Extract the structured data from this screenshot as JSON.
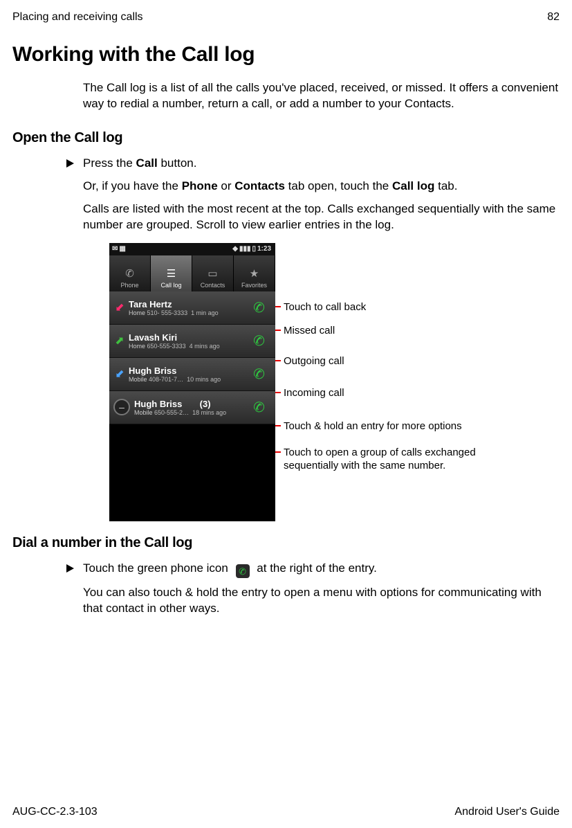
{
  "header": {
    "section": "Placing and receiving calls",
    "page": "82"
  },
  "title": "Working with the Call log",
  "intro": "The Call log is a list of all the calls you've placed, received, or missed. It offers a convenient way to redial a number, return a call, or add a number to your Contacts.",
  "open": {
    "heading": "Open the Call log",
    "step_prefix": "Press the ",
    "step_bold": "Call",
    "step_suffix": " button.",
    "or_prefix": "Or, if you have the ",
    "or_b1": "Phone",
    "or_mid1": " or ",
    "or_b2": "Contacts",
    "or_mid2": " tab open, touch the ",
    "or_b3": "Call log",
    "or_suffix": " tab.",
    "note": "Calls are listed with the most recent at the top. Calls exchanged sequentially with the same number are grouped. Scroll to view earlier entries in the log."
  },
  "phone": {
    "time": "1:23",
    "tabs": [
      "Phone",
      "Call log",
      "Contacts",
      "Favorites"
    ],
    "rows": [
      {
        "name": "Tara Hertz",
        "label": "Home",
        "number": "510- 555-3333",
        "ago": "1 min ago",
        "count": ""
      },
      {
        "name": "Lavash Kiri",
        "label": "Home",
        "number": "650-555-3333",
        "ago": "4 mins ago",
        "count": ""
      },
      {
        "name": "Hugh Briss",
        "label": "Mobile",
        "number": "408-701-7…",
        "ago": "10 mins ago",
        "count": ""
      },
      {
        "name": "Hugh Briss",
        "label": "Mobile",
        "number": "650-555-2…",
        "ago": "18 mins ago",
        "count": "(3)"
      }
    ]
  },
  "callouts": {
    "c1": "Touch to call back",
    "c2": "Missed call",
    "c3": "Outgoing call",
    "c4": "Incoming call",
    "c5": "Touch & hold an entry for more options",
    "c6": "Touch to open a group of calls exchanged sequentially with the same number."
  },
  "dial": {
    "heading": "Dial a number in the Call log",
    "step_prefix": "Touch the green phone icon ",
    "step_suffix": " at the right of the entry.",
    "note": "You can also touch & hold the entry to open a menu with options for communicating with that contact in other ways."
  },
  "footer": {
    "doc_id": "AUG-CC-2.3-103",
    "book": "Android User's Guide"
  }
}
